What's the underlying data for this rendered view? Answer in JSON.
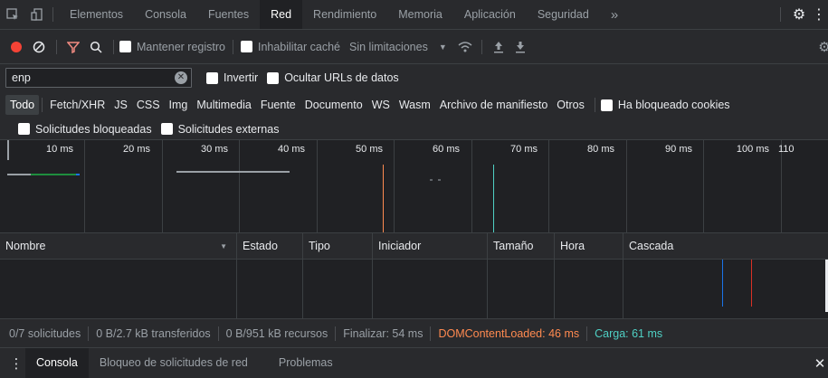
{
  "tabs": [
    "Elementos",
    "Consola",
    "Fuentes",
    "Red",
    "Rendimiento",
    "Memoria",
    "Aplicación",
    "Seguridad"
  ],
  "more_tabs": "»",
  "toolbar": {
    "preserve_log": "Mantener registro",
    "disable_cache": "Inhabilitar caché",
    "throttling": "Sin limitaciones"
  },
  "filter": {
    "value": "enp",
    "invert": "Invertir",
    "hide_data_urls": "Ocultar URLs de datos"
  },
  "types": [
    "Todo",
    "Fetch/XHR",
    "JS",
    "CSS",
    "Img",
    "Multimedia",
    "Fuente",
    "Documento",
    "WS",
    "Wasm",
    "Archivo de manifiesto",
    "Otros"
  ],
  "blocked_cookies": "Ha bloqueado cookies",
  "blocked_requests": "Solicitudes bloqueadas",
  "third_party": "Solicitudes externas",
  "timeline_labels": [
    "10 ms",
    "20 ms",
    "30 ms",
    "40 ms",
    "50 ms",
    "60 ms",
    "70 ms",
    "80 ms",
    "90 ms",
    "100 ms",
    "110"
  ],
  "columns": [
    "Nombre",
    "Estado",
    "Tipo",
    "Iniciador",
    "Tamaño",
    "Hora",
    "Cascada"
  ],
  "status": {
    "requests": "0/7 solicitudes",
    "transferred": "0 B/2.7 kB transferidos",
    "resources": "0 B/951 kB recursos",
    "finish": "Finalizar: 54 ms",
    "dom_content_loaded": "DOMContentLoaded: 46 ms",
    "load": "Carga: 61 ms"
  },
  "drawer_tabs": [
    "Consola",
    "Bloqueo de solicitudes de red",
    "Problemas"
  ],
  "colors": {
    "accent_record": "#f44336",
    "dom_content_loaded": "#ff8a50",
    "load": "#4fd0c4",
    "filter_funnel": "#f28b82"
  }
}
